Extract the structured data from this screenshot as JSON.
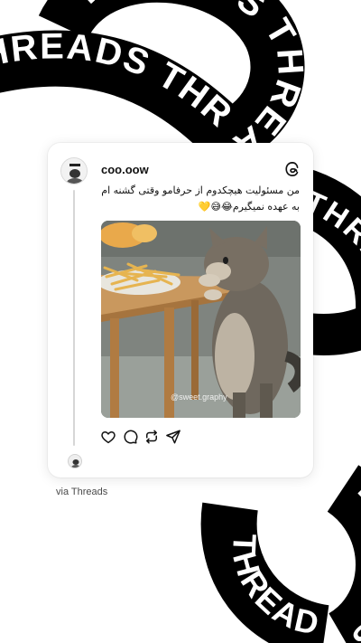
{
  "background": {
    "ribbon_text": "THREADS",
    "ribbon_color": "#000000",
    "ribbon_text_color": "#ffffff"
  },
  "post": {
    "username": "coo.oow",
    "text": "من مسئولیت هیچکدوم از حرفامو وقتی گشنه ام به عهده نمیگیرم😂😅💛",
    "media": {
      "watermark": "@sweet.graphy",
      "description": "cat reaching for a plate of fries on a wooden table"
    }
  },
  "actions": [
    "heart-icon",
    "comment-icon",
    "repost-icon",
    "share-icon"
  ],
  "footer": {
    "via_label": "via Threads"
  }
}
